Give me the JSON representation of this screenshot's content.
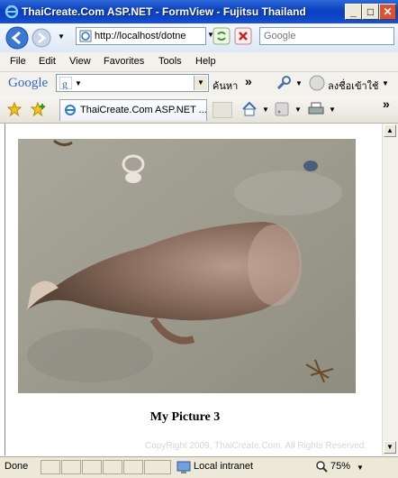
{
  "window": {
    "title": "ThaiCreate.Com ASP.NET - FormView - Fujitsu Thailand",
    "min": "_",
    "max": "□",
    "close": "✕"
  },
  "nav": {
    "address": "http://localhost/dotne",
    "search_placeholder": "Google"
  },
  "menu": [
    "File",
    "Edit",
    "View",
    "Favorites",
    "Tools",
    "Help"
  ],
  "google": {
    "logo": "Google",
    "search_button": "ค้นหา",
    "signin": "ลงชื่อเข้าใช้"
  },
  "tab": {
    "label": "ThaiCreate.Com ASP.NET ..."
  },
  "page": {
    "caption": "My Picture 3",
    "copyright": "CopyRight 2009, ThaiCreate.Com. All Rights Reserved."
  },
  "status": {
    "text": "Done",
    "zone": "Local intranet",
    "zoom": "75%"
  },
  "colors": {
    "titlebar": "#0a3fc0",
    "chrome": "#ece9d8"
  }
}
